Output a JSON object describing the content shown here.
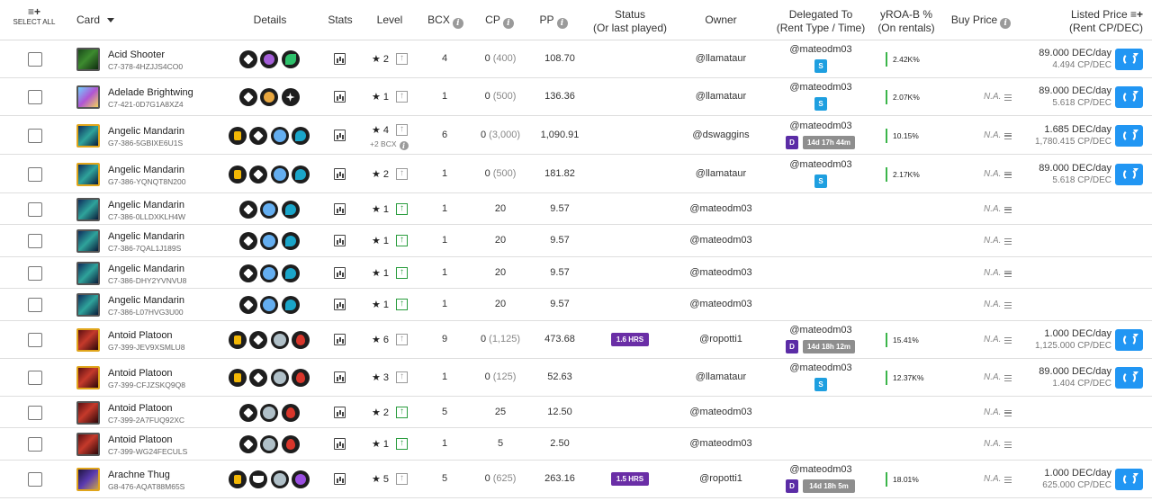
{
  "header": {
    "select_all_icon": "≡+",
    "select_all_label": "SELECT ALL",
    "card": "Card",
    "card_sort_icon": "chevron-down-icon",
    "details": "Details",
    "stats": "Stats",
    "level": "Level",
    "bcx": "BCX",
    "cp": "CP",
    "pp": "PP",
    "status_line1": "Status",
    "status_line2": "(Or last played)",
    "owner": "Owner",
    "delegated_line1": "Delegated To",
    "delegated_line2": "(Rent Type / Time)",
    "yroa_line1": "yROA-B %",
    "yroa_line2": "(On rentals)",
    "buy_price": "Buy Price",
    "listed_line1": "Listed Price",
    "listed_line2": "(Rent CP/DEC)",
    "listed_icon": "≡+",
    "info_glyph": "i"
  },
  "rows": [
    {
      "name": "Acid Shooter",
      "uid": "C7-378-4HZJJS4CO0",
      "thumb": "acid",
      "gold": false,
      "icons": [
        "ed",
        "purple",
        "green"
      ],
      "level": "2",
      "up": "grey",
      "bcx_note": "",
      "bcx": "4",
      "cp": "0",
      "cp_paren": "(400)",
      "pp": "108.70",
      "status": "",
      "owner": "@llamataur",
      "deleg": "@mateodm03",
      "tag1": "S",
      "tag2": "",
      "yroa": "2.42K%",
      "na": "",
      "price": "89.000 DEC/day",
      "pricesub": "4.494 CP/DEC",
      "refresh": true
    },
    {
      "name": "Adelade Brightwing",
      "uid": "C7-421-0D7G1A8XZ4",
      "thumb": "adel",
      "gold": false,
      "icons": [
        "ed",
        "orange",
        "star"
      ],
      "level": "1",
      "up": "grey",
      "bcx_note": "",
      "bcx": "1",
      "cp": "0",
      "cp_paren": "(500)",
      "pp": "136.36",
      "status": "",
      "owner": "@llamataur",
      "deleg": "@mateodm03",
      "tag1": "S",
      "tag2": "",
      "yroa": "2.07K%",
      "na": "N.A.",
      "price": "89.000 DEC/day",
      "pricesub": "5.618 CP/DEC",
      "refresh": true
    },
    {
      "name": "Angelic Mandarin",
      "uid": "G7-386-5GBIXE6U1S",
      "thumb": "ang",
      "gold": true,
      "icons": [
        "gold",
        "ed",
        "blue",
        "water"
      ],
      "level": "4",
      "up": "grey",
      "bcx_note": "+2 BCX",
      "bcx": "6",
      "cp": "0",
      "cp_paren": "(3,000)",
      "pp": "1,090.91",
      "status": "",
      "owner": "@dswaggins",
      "deleg": "@mateodm03",
      "tag1": "D",
      "tag2": "14d 17h 44m",
      "yroa": "10.15%",
      "na": "N.A.",
      "price": "1.685 DEC/day",
      "pricesub": "1,780.415 CP/DEC",
      "refresh": true
    },
    {
      "name": "Angelic Mandarin",
      "uid": "G7-386-YQNQT8N200",
      "thumb": "ang",
      "gold": true,
      "icons": [
        "gold",
        "ed",
        "blue",
        "water"
      ],
      "level": "2",
      "up": "grey",
      "bcx_note": "",
      "bcx": "1",
      "cp": "0",
      "cp_paren": "(500)",
      "pp": "181.82",
      "status": "",
      "owner": "@llamataur",
      "deleg": "@mateodm03",
      "tag1": "S",
      "tag2": "",
      "yroa": "2.17K%",
      "na": "N.A.",
      "price": "89.000 DEC/day",
      "pricesub": "5.618 CP/DEC",
      "refresh": true
    },
    {
      "name": "Angelic Mandarin",
      "uid": "C7-386-0LLDXKLH4W",
      "thumb": "ang",
      "gold": false,
      "icons": [
        "ed",
        "blue",
        "water"
      ],
      "level": "1",
      "up": "green",
      "bcx_note": "",
      "bcx": "1",
      "cp": "20",
      "cp_paren": "",
      "pp": "9.57",
      "status": "",
      "owner": "@mateodm03",
      "deleg": "",
      "tag1": "",
      "tag2": "",
      "yroa": "",
      "na": "N.A.",
      "price": "",
      "pricesub": "",
      "refresh": false
    },
    {
      "name": "Angelic Mandarin",
      "uid": "C7-386-7QAL1J189S",
      "thumb": "ang",
      "gold": false,
      "icons": [
        "ed",
        "blue",
        "water"
      ],
      "level": "1",
      "up": "green",
      "bcx_note": "",
      "bcx": "1",
      "cp": "20",
      "cp_paren": "",
      "pp": "9.57",
      "status": "",
      "owner": "@mateodm03",
      "deleg": "",
      "tag1": "",
      "tag2": "",
      "yroa": "",
      "na": "N.A.",
      "price": "",
      "pricesub": "",
      "refresh": false
    },
    {
      "name": "Angelic Mandarin",
      "uid": "C7-386-DHY2YVNVU8",
      "thumb": "ang",
      "gold": false,
      "icons": [
        "ed",
        "blue",
        "water"
      ],
      "level": "1",
      "up": "green",
      "bcx_note": "",
      "bcx": "1",
      "cp": "20",
      "cp_paren": "",
      "pp": "9.57",
      "status": "",
      "owner": "@mateodm03",
      "deleg": "",
      "tag1": "",
      "tag2": "",
      "yroa": "",
      "na": "N.A.",
      "price": "",
      "pricesub": "",
      "refresh": false
    },
    {
      "name": "Angelic Mandarin",
      "uid": "C7-386-L07HVG3U00",
      "thumb": "ang",
      "gold": false,
      "icons": [
        "ed",
        "blue",
        "water"
      ],
      "level": "1",
      "up": "green",
      "bcx_note": "",
      "bcx": "1",
      "cp": "20",
      "cp_paren": "",
      "pp": "9.57",
      "status": "",
      "owner": "@mateodm03",
      "deleg": "",
      "tag1": "",
      "tag2": "",
      "yroa": "",
      "na": "N.A.",
      "price": "",
      "pricesub": "",
      "refresh": false
    },
    {
      "name": "Antoid Platoon",
      "uid": "G7-399-JEV9XSMLU8",
      "thumb": "ant",
      "gold": true,
      "icons": [
        "gold",
        "ed",
        "grey",
        "fire"
      ],
      "level": "6",
      "up": "grey",
      "bcx_note": "",
      "bcx": "9",
      "cp": "0",
      "cp_paren": "(1,125)",
      "pp": "473.68",
      "status": "1.6 HRS",
      "owner": "@ropotti1",
      "deleg": "@mateodm03",
      "tag1": "D",
      "tag2": "14d 18h 12m",
      "yroa": "15.41%",
      "na": "N.A.",
      "price": "1.000 DEC/day",
      "pricesub": "1,125.000 CP/DEC",
      "refresh": true
    },
    {
      "name": "Antoid Platoon",
      "uid": "G7-399-CFJZSKQ9Q8",
      "thumb": "ant",
      "gold": true,
      "icons": [
        "gold",
        "ed",
        "grey",
        "fire"
      ],
      "level": "3",
      "up": "grey",
      "bcx_note": "",
      "bcx": "1",
      "cp": "0",
      "cp_paren": "(125)",
      "pp": "52.63",
      "status": "",
      "owner": "@llamataur",
      "deleg": "@mateodm03",
      "tag1": "S",
      "tag2": "",
      "yroa": "12.37K%",
      "na": "N.A.",
      "price": "89.000 DEC/day",
      "pricesub": "1.404 CP/DEC",
      "refresh": true
    },
    {
      "name": "Antoid Platoon",
      "uid": "C7-399-2A7FUQ92XC",
      "thumb": "ant",
      "gold": false,
      "icons": [
        "ed",
        "grey",
        "fire"
      ],
      "level": "2",
      "up": "green",
      "bcx_note": "",
      "bcx": "5",
      "cp": "25",
      "cp_paren": "",
      "pp": "12.50",
      "status": "",
      "owner": "@mateodm03",
      "deleg": "",
      "tag1": "",
      "tag2": "",
      "yroa": "",
      "na": "N.A.",
      "price": "",
      "pricesub": "",
      "refresh": false
    },
    {
      "name": "Antoid Platoon",
      "uid": "C7-399-WG24FECULS",
      "thumb": "ant",
      "gold": false,
      "icons": [
        "ed",
        "grey",
        "fire"
      ],
      "level": "1",
      "up": "green",
      "bcx_note": "",
      "bcx": "1",
      "cp": "5",
      "cp_paren": "",
      "pp": "2.50",
      "status": "",
      "owner": "@mateodm03",
      "deleg": "",
      "tag1": "",
      "tag2": "",
      "yroa": "",
      "na": "N.A.",
      "price": "",
      "pricesub": "",
      "refresh": false
    },
    {
      "name": "Arachne Thug",
      "uid": "G8-476-AQAT88M65S",
      "thumb": "ara",
      "gold": true,
      "icons": [
        "gold",
        "wing",
        "grey",
        "death"
      ],
      "level": "5",
      "up": "grey",
      "bcx_note": "",
      "bcx": "5",
      "cp": "0",
      "cp_paren": "(625)",
      "pp": "263.16",
      "status": "1.5 HRS",
      "owner": "@ropotti1",
      "deleg": "@mateodm03",
      "tag1": "D",
      "tag2": "14d 18h 5m",
      "yroa": "18.01%",
      "na": "N.A.",
      "price": "1.000 DEC/day",
      "pricesub": "625.000 CP/DEC",
      "refresh": true
    }
  ]
}
